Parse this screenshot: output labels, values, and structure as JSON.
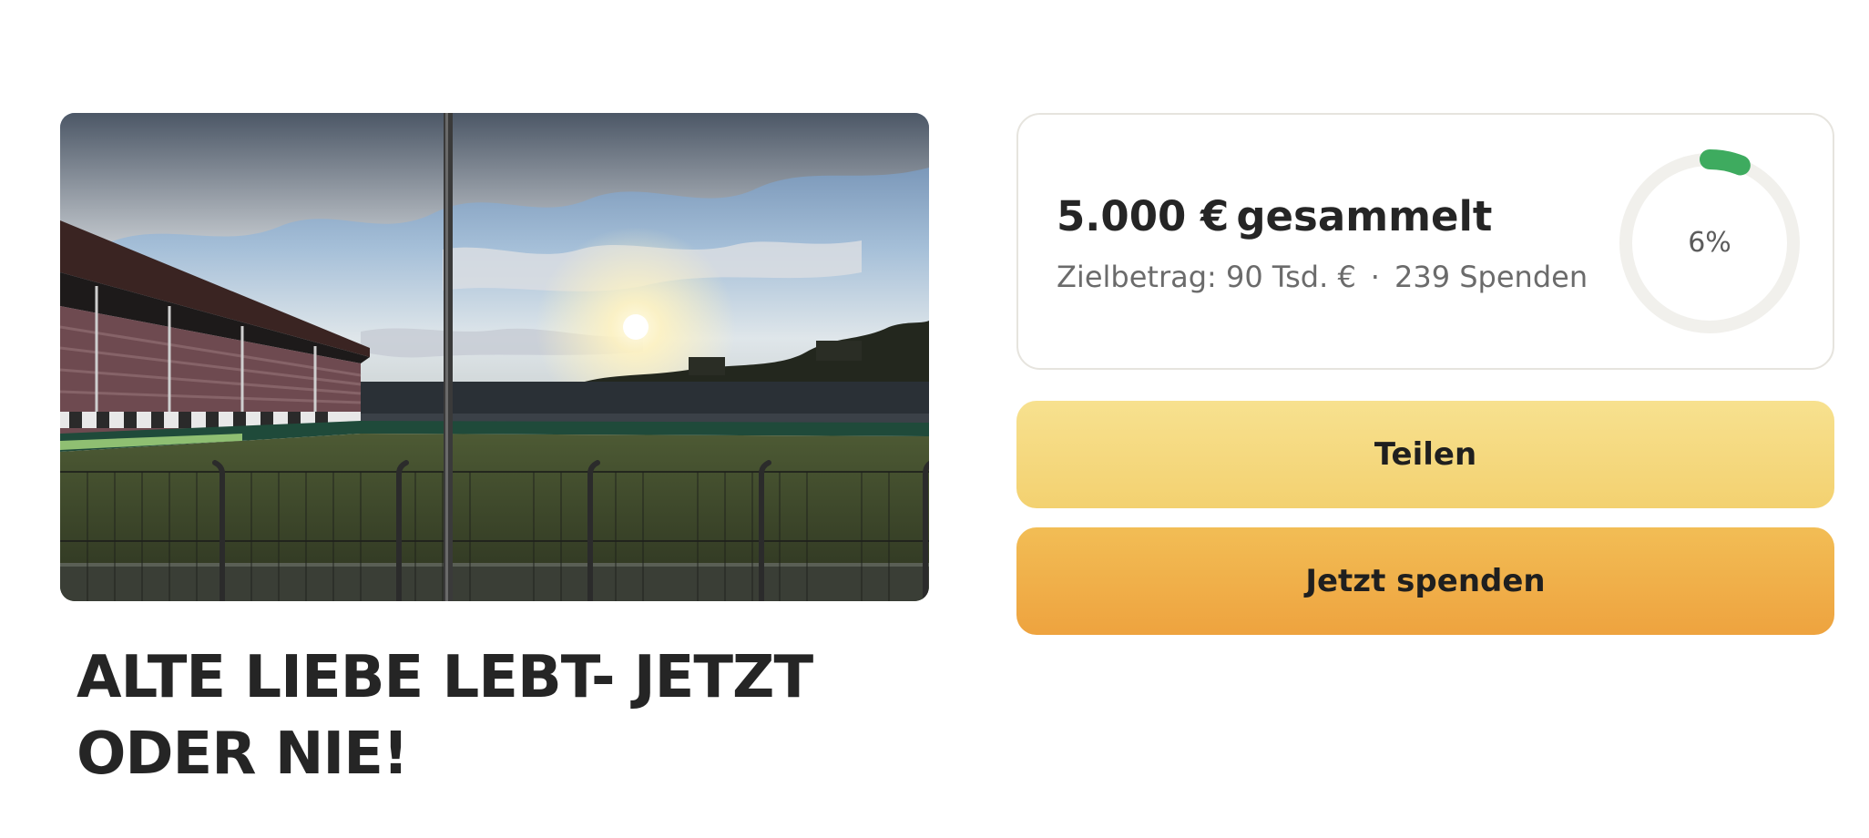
{
  "campaign": {
    "title": "ALTE LIEBE LEBT- JETZT ODER NIE!",
    "image_alt": "Fußballstadion mit Tribüne bei Gegenlicht",
    "image_icon": "stadium-photo"
  },
  "progress": {
    "raised_amount": "5.000 €",
    "raised_label": "gesammelt",
    "goal_text": "Zielbetrag: 90 Tsd. €",
    "separator": "·",
    "donations_text": "239 Spenden",
    "percent_label": "6%",
    "percent_value": 6,
    "ring_color": "#3eab5f",
    "ring_track_color": "#f1f0ec"
  },
  "actions": {
    "share_label": "Teilen",
    "donate_label": "Jetzt spenden"
  },
  "colors": {
    "share_button": "#f5d97e",
    "donate_button": "#f0b04a",
    "text": "#252525"
  }
}
